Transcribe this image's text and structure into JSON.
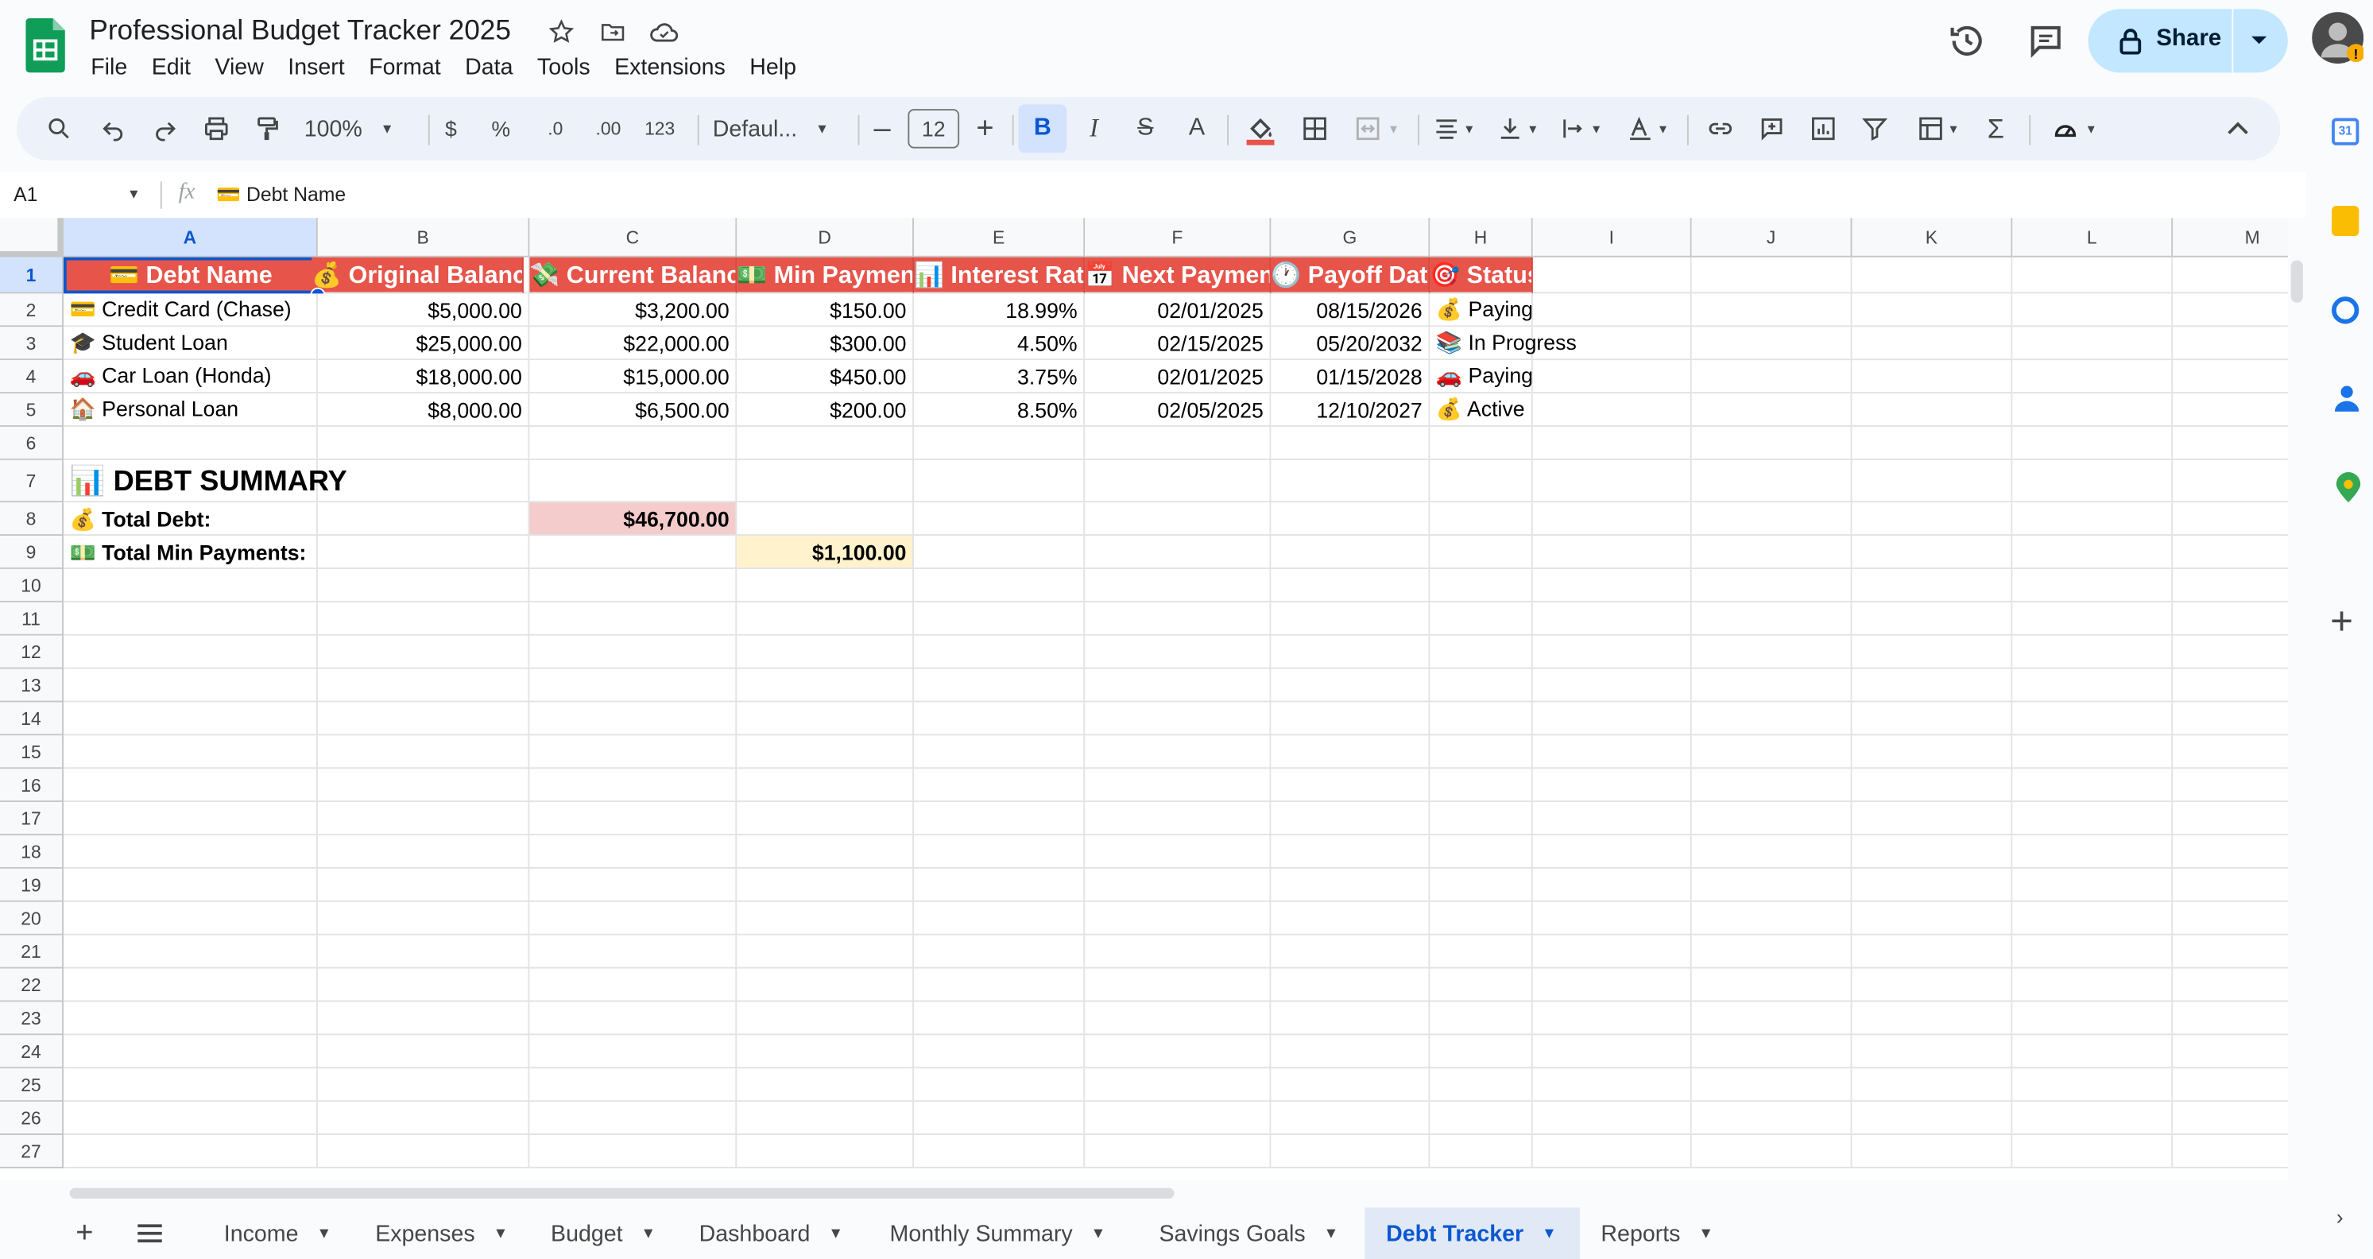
{
  "app": {
    "title": "Professional Budget Tracker 2025",
    "menu": [
      "File",
      "Edit",
      "View",
      "Insert",
      "Format",
      "Data",
      "Tools",
      "Extensions",
      "Help"
    ],
    "share_label": "Share"
  },
  "toolbar": {
    "zoom": "100%",
    "currency": "$",
    "percent": "%",
    "dec_decrease": ".0",
    "dec_increase": ".00",
    "num_format": "123",
    "font": "Defaul...",
    "font_size": "12",
    "bold": "B",
    "italic": "I",
    "strike": "S",
    "text_color": "A"
  },
  "formula_bar": {
    "cell_ref": "A1",
    "fx": "fx",
    "content": "💳 Debt Name"
  },
  "columns": [
    "A",
    "B",
    "C",
    "D",
    "E",
    "F",
    "G",
    "H",
    "I",
    "J",
    "K",
    "L",
    "M"
  ],
  "rows": [
    "1",
    "2",
    "3",
    "4",
    "5",
    "6",
    "7",
    "8",
    "9",
    "10",
    "11",
    "12",
    "13",
    "14",
    "15",
    "16",
    "17",
    "18",
    "19",
    "20",
    "21",
    "22",
    "23",
    "24",
    "25",
    "26",
    "27"
  ],
  "sheet": {
    "headers": [
      "💳 Debt Name",
      "💰 Original Balance",
      "💸 Current Balance",
      "💵 Min Payment",
      "📊 Interest Rate",
      "📅 Next Payment",
      "🕐 Payoff Date",
      "🎯 Status"
    ],
    "debts": [
      {
        "name": "💳 Credit Card (Chase)",
        "original": "$5,000.00",
        "current": "$3,200.00",
        "min": "$150.00",
        "rate": "18.99%",
        "next": "02/01/2025",
        "payoff": "08/15/2026",
        "status": "💰 Paying"
      },
      {
        "name": "🎓 Student Loan",
        "original": "$25,000.00",
        "current": "$22,000.00",
        "min": "$300.00",
        "rate": "4.50%",
        "next": "02/15/2025",
        "payoff": "05/20/2032",
        "status": "📚 In Progress"
      },
      {
        "name": "🚗 Car Loan (Honda)",
        "original": "$18,000.00",
        "current": "$15,000.00",
        "min": "$450.00",
        "rate": "3.75%",
        "next": "02/01/2025",
        "payoff": "01/15/2028",
        "status": "🚗 Paying"
      },
      {
        "name": "🏠 Personal Loan",
        "original": "$8,000.00",
        "current": "$6,500.00",
        "min": "$200.00",
        "rate": "8.50%",
        "next": "02/05/2025",
        "payoff": "12/10/2027",
        "status": "💰 Active"
      }
    ],
    "summary_title": "📊 DEBT SUMMARY",
    "total_debt_label": "💰 Total Debt:",
    "total_debt_value": "$46,700.00",
    "total_min_label": "💵 Total Min Payments:",
    "total_min_value": "$1,100.00"
  },
  "tabs": [
    "Income",
    "Expenses",
    "Budget",
    "Dashboard",
    "Monthly Summary",
    "Savings Goals",
    "Debt Tracker",
    "Reports"
  ],
  "active_tab": "Debt Tracker",
  "colors": {
    "header_red": "#e7544a",
    "total_debt_bg": "#f4cccc",
    "total_min_bg": "#fff2cc",
    "accent": "#0b57d0"
  }
}
